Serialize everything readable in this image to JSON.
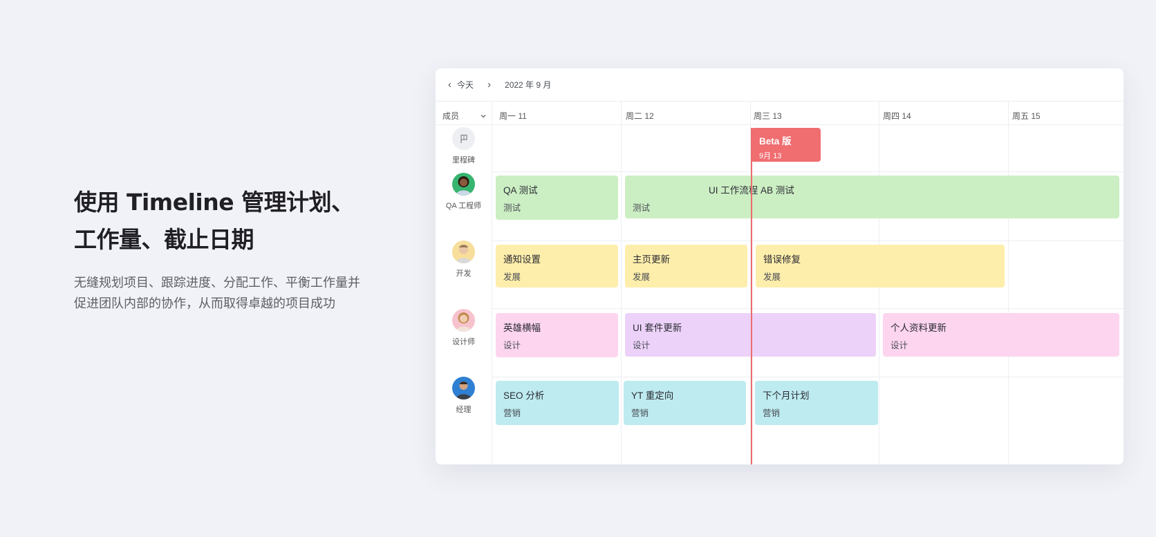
{
  "hero": {
    "title_line1": "使用 Timeline 管理计划、",
    "title_line2": "工作量、截止日期",
    "description": "无缝规划项目、跟踪进度、分配工作、平衡工作量并促进团队内部的协作，从而取得卓越的项目成功"
  },
  "toolbar": {
    "prev_icon": "chevron-left-icon",
    "today_label": "今天",
    "next_icon": "chevron-right-icon",
    "month_label": "2022 年 9 月"
  },
  "filter": {
    "label": "成员",
    "icon": "chevron-down-icon"
  },
  "days": [
    {
      "label": "周一 11"
    },
    {
      "label": "周二 12"
    },
    {
      "label": "周三 13"
    },
    {
      "label": "周四 14"
    },
    {
      "label": "周五 15"
    }
  ],
  "members": [
    {
      "label": "里程碑",
      "icon": "flag-icon"
    },
    {
      "label": "QA 工程师"
    },
    {
      "label": "开发"
    },
    {
      "label": "设计师"
    },
    {
      "label": "经理"
    }
  ],
  "milestone": {
    "title": "Beta 版",
    "date": "9月 13"
  },
  "tasks": {
    "qa_test": {
      "title": "QA 测试",
      "sub": "测试"
    },
    "ui_flow_ab": {
      "title": "UI 工作流程 AB 测试",
      "sub": "测试"
    },
    "notify_settings": {
      "title": "通知设置",
      "sub": "发展"
    },
    "homepage_update": {
      "title": "主页更新",
      "sub": "发展"
    },
    "bug_fix": {
      "title": "错误修复",
      "sub": "发展"
    },
    "hero_banner": {
      "title": "英雄横幅",
      "sub": "设计"
    },
    "ui_kit_update": {
      "title": "UI 套件更新",
      "sub": "设计"
    },
    "profile_update": {
      "title": "个人资料更新",
      "sub": "设计"
    },
    "seo_analysis": {
      "title": "SEO 分析",
      "sub": "营销"
    },
    "yt_retarget": {
      "title": "YT 重定向",
      "sub": "营销"
    },
    "next_month_plan": {
      "title": "下个月计划",
      "sub": "营销"
    }
  },
  "colors": {
    "testing": "#cbeec3",
    "development": "#feeeab",
    "design": "#fdd5ef",
    "design_purple": "#ecd2f9",
    "marketing": "#bdebf0",
    "milestone": "#f06d70"
  }
}
